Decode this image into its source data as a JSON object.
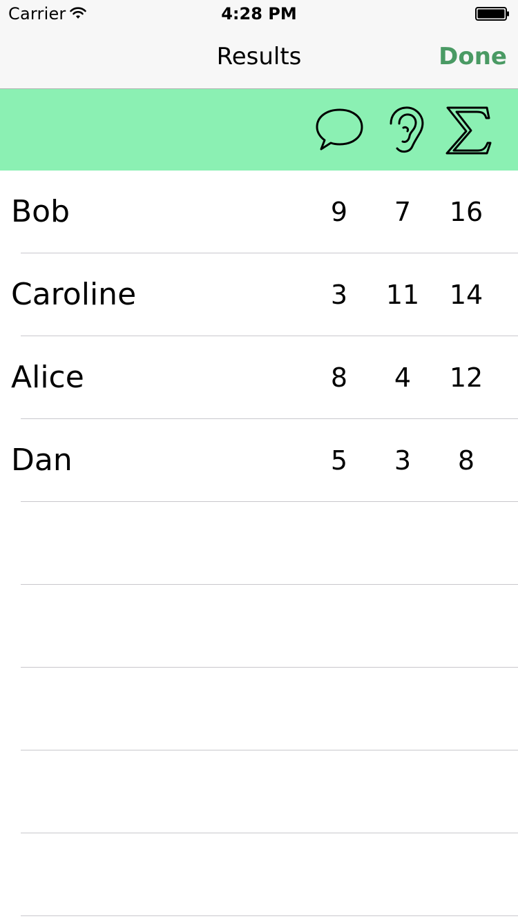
{
  "status_bar": {
    "carrier": "Carrier",
    "time": "4:28 PM",
    "wifi_icon": "wifi-icon",
    "battery_icon": "battery-icon"
  },
  "nav": {
    "title": "Results",
    "done_label": "Done"
  },
  "header": {
    "background_color": "#8bf0b3",
    "icons": [
      "speech-bubble-icon",
      "ear-icon",
      "sigma-icon"
    ]
  },
  "colors": {
    "accent": "#4a9a64"
  },
  "rows": [
    {
      "name": "Bob",
      "spoken": "9",
      "listened": "7",
      "total": "16"
    },
    {
      "name": "Caroline",
      "spoken": "3",
      "listened": "11",
      "total": "14"
    },
    {
      "name": "Alice",
      "spoken": "8",
      "listened": "4",
      "total": "12"
    },
    {
      "name": "Dan",
      "spoken": "5",
      "listened": "3",
      "total": "8"
    },
    {
      "name": "",
      "spoken": "",
      "listened": "",
      "total": ""
    },
    {
      "name": "",
      "spoken": "",
      "listened": "",
      "total": ""
    },
    {
      "name": "",
      "spoken": "",
      "listened": "",
      "total": ""
    },
    {
      "name": "",
      "spoken": "",
      "listened": "",
      "total": ""
    },
    {
      "name": "",
      "spoken": "",
      "listened": "",
      "total": ""
    }
  ]
}
